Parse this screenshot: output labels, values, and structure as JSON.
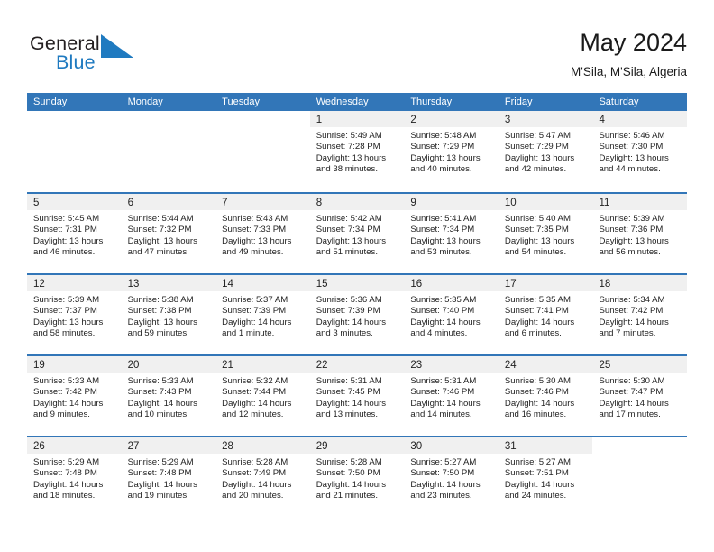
{
  "brand": {
    "name_part1": "General",
    "name_part2": "Blue",
    "accent_color": "#1f7ac0"
  },
  "header": {
    "month_title": "May 2024",
    "location": "M'Sila, M'Sila, Algeria"
  },
  "colors": {
    "header_blue": "#3276b8",
    "daynum_band": "#f0f0f0",
    "text": "#222222"
  },
  "weekdays": [
    "Sunday",
    "Monday",
    "Tuesday",
    "Wednesday",
    "Thursday",
    "Friday",
    "Saturday"
  ],
  "weeks": [
    [
      {
        "day": "",
        "sunrise": "",
        "sunset": "",
        "daylight1": "",
        "daylight2": ""
      },
      {
        "day": "",
        "sunrise": "",
        "sunset": "",
        "daylight1": "",
        "daylight2": ""
      },
      {
        "day": "",
        "sunrise": "",
        "sunset": "",
        "daylight1": "",
        "daylight2": ""
      },
      {
        "day": "1",
        "sunrise": "Sunrise: 5:49 AM",
        "sunset": "Sunset: 7:28 PM",
        "daylight1": "Daylight: 13 hours",
        "daylight2": "and 38 minutes."
      },
      {
        "day": "2",
        "sunrise": "Sunrise: 5:48 AM",
        "sunset": "Sunset: 7:29 PM",
        "daylight1": "Daylight: 13 hours",
        "daylight2": "and 40 minutes."
      },
      {
        "day": "3",
        "sunrise": "Sunrise: 5:47 AM",
        "sunset": "Sunset: 7:29 PM",
        "daylight1": "Daylight: 13 hours",
        "daylight2": "and 42 minutes."
      },
      {
        "day": "4",
        "sunrise": "Sunrise: 5:46 AM",
        "sunset": "Sunset: 7:30 PM",
        "daylight1": "Daylight: 13 hours",
        "daylight2": "and 44 minutes."
      }
    ],
    [
      {
        "day": "5",
        "sunrise": "Sunrise: 5:45 AM",
        "sunset": "Sunset: 7:31 PM",
        "daylight1": "Daylight: 13 hours",
        "daylight2": "and 46 minutes."
      },
      {
        "day": "6",
        "sunrise": "Sunrise: 5:44 AM",
        "sunset": "Sunset: 7:32 PM",
        "daylight1": "Daylight: 13 hours",
        "daylight2": "and 47 minutes."
      },
      {
        "day": "7",
        "sunrise": "Sunrise: 5:43 AM",
        "sunset": "Sunset: 7:33 PM",
        "daylight1": "Daylight: 13 hours",
        "daylight2": "and 49 minutes."
      },
      {
        "day": "8",
        "sunrise": "Sunrise: 5:42 AM",
        "sunset": "Sunset: 7:34 PM",
        "daylight1": "Daylight: 13 hours",
        "daylight2": "and 51 minutes."
      },
      {
        "day": "9",
        "sunrise": "Sunrise: 5:41 AM",
        "sunset": "Sunset: 7:34 PM",
        "daylight1": "Daylight: 13 hours",
        "daylight2": "and 53 minutes."
      },
      {
        "day": "10",
        "sunrise": "Sunrise: 5:40 AM",
        "sunset": "Sunset: 7:35 PM",
        "daylight1": "Daylight: 13 hours",
        "daylight2": "and 54 minutes."
      },
      {
        "day": "11",
        "sunrise": "Sunrise: 5:39 AM",
        "sunset": "Sunset: 7:36 PM",
        "daylight1": "Daylight: 13 hours",
        "daylight2": "and 56 minutes."
      }
    ],
    [
      {
        "day": "12",
        "sunrise": "Sunrise: 5:39 AM",
        "sunset": "Sunset: 7:37 PM",
        "daylight1": "Daylight: 13 hours",
        "daylight2": "and 58 minutes."
      },
      {
        "day": "13",
        "sunrise": "Sunrise: 5:38 AM",
        "sunset": "Sunset: 7:38 PM",
        "daylight1": "Daylight: 13 hours",
        "daylight2": "and 59 minutes."
      },
      {
        "day": "14",
        "sunrise": "Sunrise: 5:37 AM",
        "sunset": "Sunset: 7:39 PM",
        "daylight1": "Daylight: 14 hours",
        "daylight2": "and 1 minute."
      },
      {
        "day": "15",
        "sunrise": "Sunrise: 5:36 AM",
        "sunset": "Sunset: 7:39 PM",
        "daylight1": "Daylight: 14 hours",
        "daylight2": "and 3 minutes."
      },
      {
        "day": "16",
        "sunrise": "Sunrise: 5:35 AM",
        "sunset": "Sunset: 7:40 PM",
        "daylight1": "Daylight: 14 hours",
        "daylight2": "and 4 minutes."
      },
      {
        "day": "17",
        "sunrise": "Sunrise: 5:35 AM",
        "sunset": "Sunset: 7:41 PM",
        "daylight1": "Daylight: 14 hours",
        "daylight2": "and 6 minutes."
      },
      {
        "day": "18",
        "sunrise": "Sunrise: 5:34 AM",
        "sunset": "Sunset: 7:42 PM",
        "daylight1": "Daylight: 14 hours",
        "daylight2": "and 7 minutes."
      }
    ],
    [
      {
        "day": "19",
        "sunrise": "Sunrise: 5:33 AM",
        "sunset": "Sunset: 7:42 PM",
        "daylight1": "Daylight: 14 hours",
        "daylight2": "and 9 minutes."
      },
      {
        "day": "20",
        "sunrise": "Sunrise: 5:33 AM",
        "sunset": "Sunset: 7:43 PM",
        "daylight1": "Daylight: 14 hours",
        "daylight2": "and 10 minutes."
      },
      {
        "day": "21",
        "sunrise": "Sunrise: 5:32 AM",
        "sunset": "Sunset: 7:44 PM",
        "daylight1": "Daylight: 14 hours",
        "daylight2": "and 12 minutes."
      },
      {
        "day": "22",
        "sunrise": "Sunrise: 5:31 AM",
        "sunset": "Sunset: 7:45 PM",
        "daylight1": "Daylight: 14 hours",
        "daylight2": "and 13 minutes."
      },
      {
        "day": "23",
        "sunrise": "Sunrise: 5:31 AM",
        "sunset": "Sunset: 7:46 PM",
        "daylight1": "Daylight: 14 hours",
        "daylight2": "and 14 minutes."
      },
      {
        "day": "24",
        "sunrise": "Sunrise: 5:30 AM",
        "sunset": "Sunset: 7:46 PM",
        "daylight1": "Daylight: 14 hours",
        "daylight2": "and 16 minutes."
      },
      {
        "day": "25",
        "sunrise": "Sunrise: 5:30 AM",
        "sunset": "Sunset: 7:47 PM",
        "daylight1": "Daylight: 14 hours",
        "daylight2": "and 17 minutes."
      }
    ],
    [
      {
        "day": "26",
        "sunrise": "Sunrise: 5:29 AM",
        "sunset": "Sunset: 7:48 PM",
        "daylight1": "Daylight: 14 hours",
        "daylight2": "and 18 minutes."
      },
      {
        "day": "27",
        "sunrise": "Sunrise: 5:29 AM",
        "sunset": "Sunset: 7:48 PM",
        "daylight1": "Daylight: 14 hours",
        "daylight2": "and 19 minutes."
      },
      {
        "day": "28",
        "sunrise": "Sunrise: 5:28 AM",
        "sunset": "Sunset: 7:49 PM",
        "daylight1": "Daylight: 14 hours",
        "daylight2": "and 20 minutes."
      },
      {
        "day": "29",
        "sunrise": "Sunrise: 5:28 AM",
        "sunset": "Sunset: 7:50 PM",
        "daylight1": "Daylight: 14 hours",
        "daylight2": "and 21 minutes."
      },
      {
        "day": "30",
        "sunrise": "Sunrise: 5:27 AM",
        "sunset": "Sunset: 7:50 PM",
        "daylight1": "Daylight: 14 hours",
        "daylight2": "and 23 minutes."
      },
      {
        "day": "31",
        "sunrise": "Sunrise: 5:27 AM",
        "sunset": "Sunset: 7:51 PM",
        "daylight1": "Daylight: 14 hours",
        "daylight2": "and 24 minutes."
      },
      {
        "day": "",
        "sunrise": "",
        "sunset": "",
        "daylight1": "",
        "daylight2": ""
      }
    ]
  ]
}
